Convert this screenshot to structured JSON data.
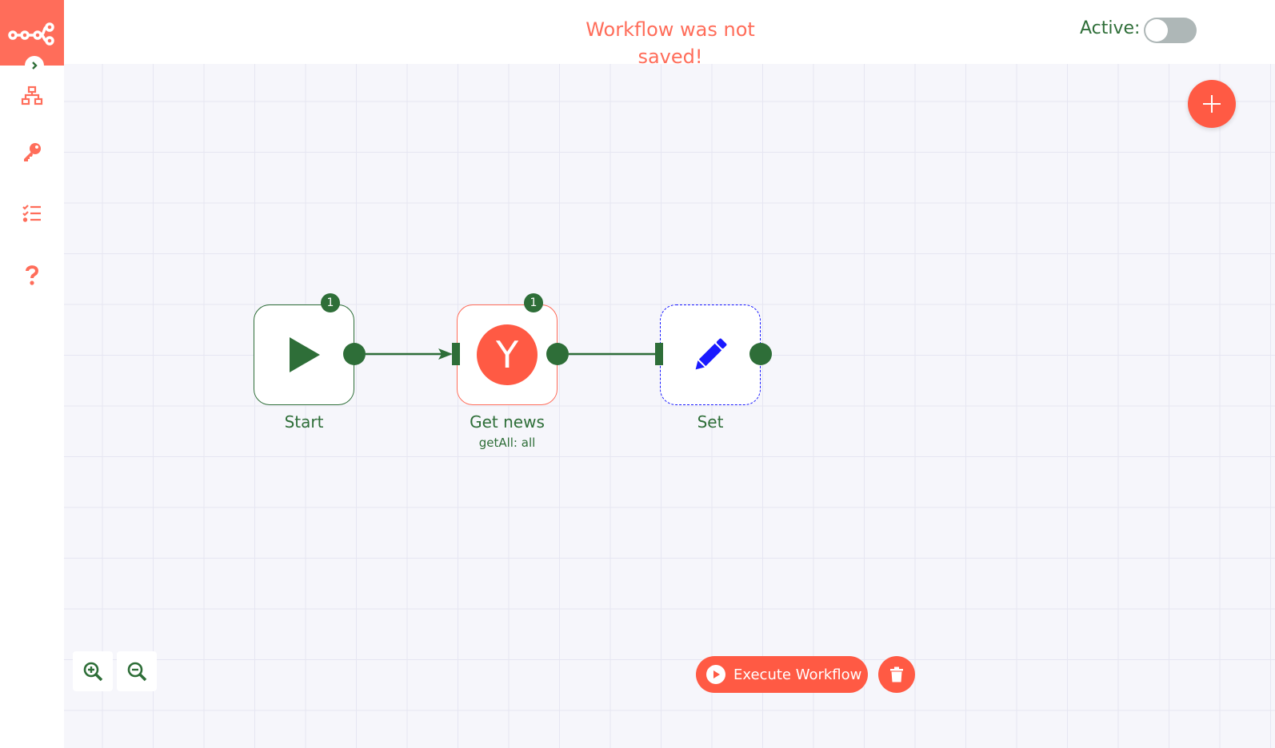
{
  "header": {
    "warning": "Workflow was not saved!",
    "active_label": "Active:",
    "active_state": false
  },
  "sidebar": {
    "items": [
      {
        "name": "workflows",
        "icon": "sitemap-icon"
      },
      {
        "name": "credentials",
        "icon": "key-icon"
      },
      {
        "name": "executions",
        "icon": "tasks-list-icon"
      },
      {
        "name": "help",
        "icon": "question-icon"
      }
    ]
  },
  "nodes": [
    {
      "label": "Start",
      "subtitle": "",
      "badge": "1",
      "icon": "play-icon"
    },
    {
      "label": "Get news",
      "subtitle": "getAll: all",
      "badge": "1",
      "icon": "hacker-news-y-icon",
      "icon_letter": "Y"
    },
    {
      "label": "Set",
      "subtitle": "",
      "badge": "",
      "icon": "pencil-icon"
    }
  ],
  "toolbar": {
    "execute_label": "Execute Workflow"
  },
  "colors": {
    "accent": "#ff6d5a",
    "success": "#2e6e38",
    "set_icon": "#1a1aff",
    "canvas": "#f6f6fb"
  }
}
